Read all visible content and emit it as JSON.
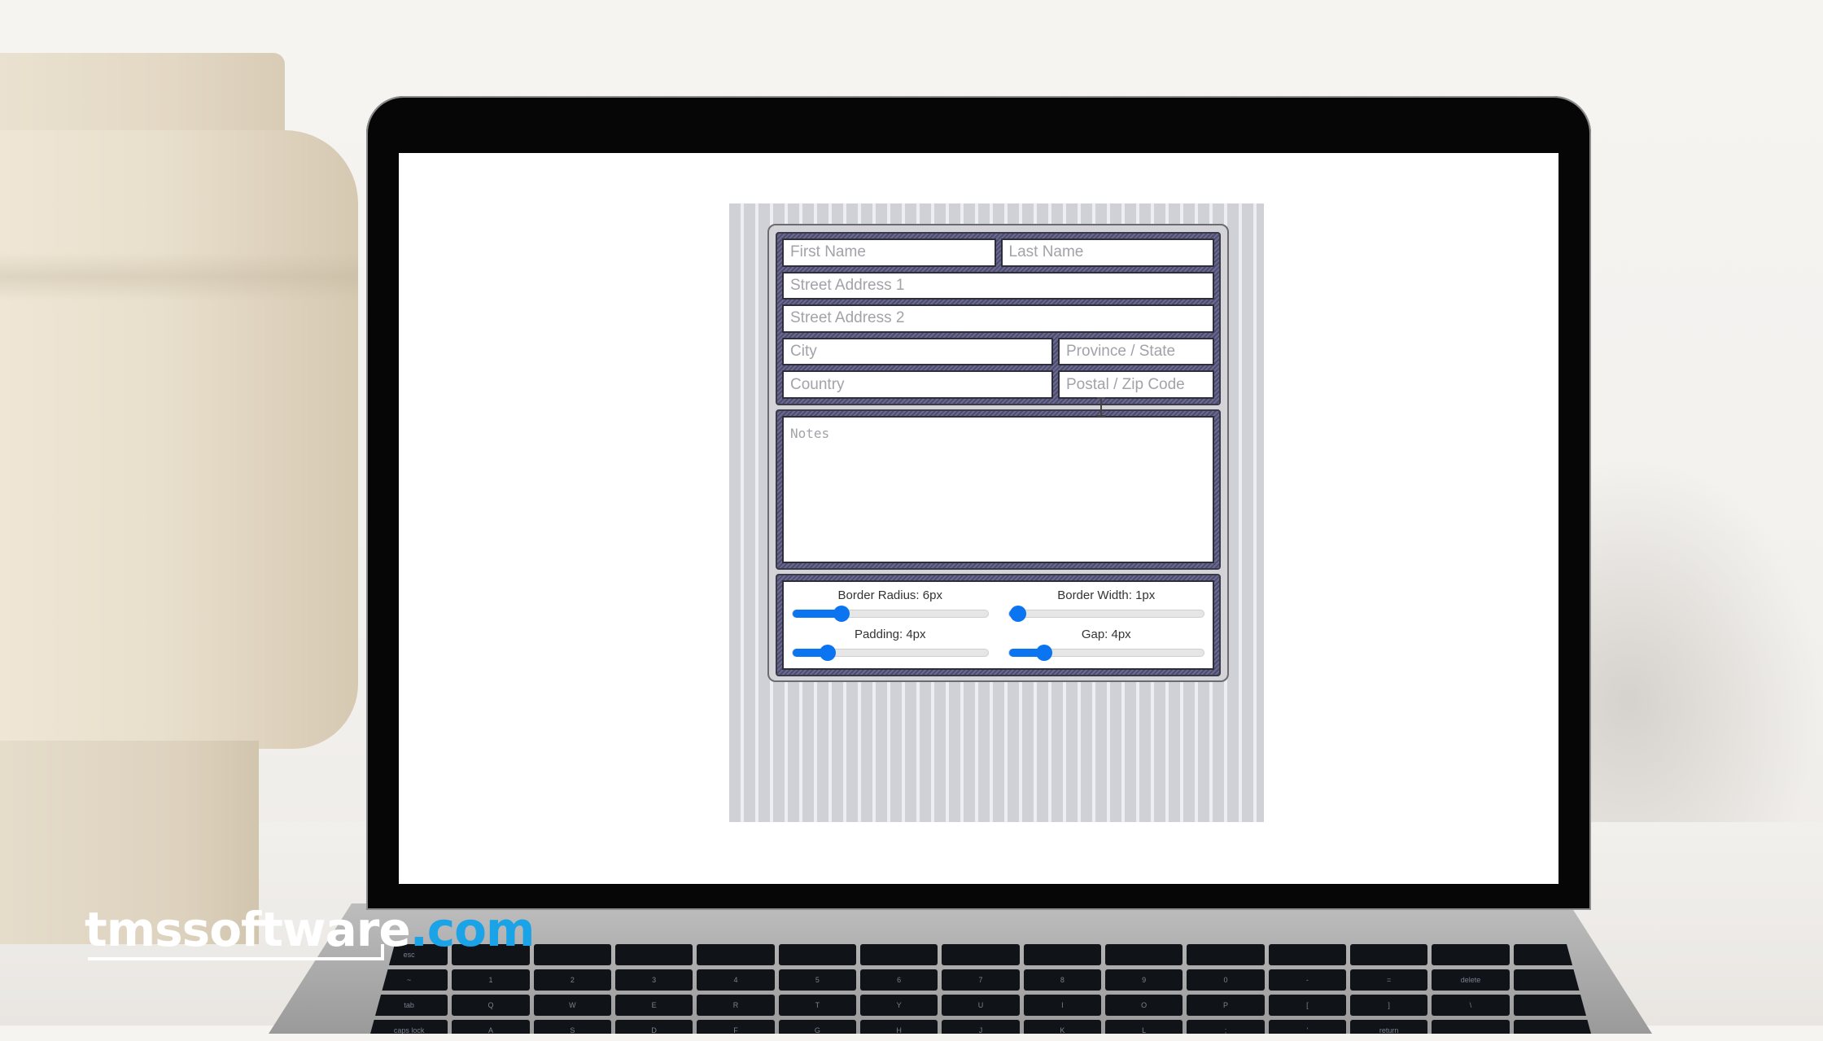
{
  "form": {
    "fields": {
      "first_name": {
        "placeholder": "First Name",
        "value": ""
      },
      "last_name": {
        "placeholder": "Last Name",
        "value": ""
      },
      "street_address_1": {
        "placeholder": "Street Address 1",
        "value": ""
      },
      "street_address_2": {
        "placeholder": "Street Address 2",
        "value": ""
      },
      "city": {
        "placeholder": "City",
        "value": ""
      },
      "province_state": {
        "placeholder": "Province / State",
        "value": ""
      },
      "country": {
        "placeholder": "Country",
        "value": ""
      },
      "postal_zip": {
        "placeholder": "Postal / Zip Code",
        "value": ""
      }
    },
    "notes": {
      "placeholder": "Notes",
      "value": ""
    }
  },
  "sliders": [
    {
      "label": "Border Radius: 6px",
      "value": 6,
      "fraction": 0.25
    },
    {
      "label": "Border Width: 1px",
      "value": 1,
      "fraction": 0.05
    },
    {
      "label": "Padding: 4px",
      "value": 4,
      "fraction": 0.18
    },
    {
      "label": "Gap: 4px",
      "value": 4,
      "fraction": 0.18
    }
  ],
  "colors": {
    "slider_accent": "#0b74f0",
    "group_border": "#4d4c6f",
    "logo_tld": "#1aa3e6"
  },
  "watermark": {
    "main": "tmssoftware",
    "tld": ".com"
  },
  "keyboard": {
    "rows": [
      [
        "esc",
        "",
        "",
        "",
        "",
        "",
        "",
        "",
        "",
        "",
        "",
        "",
        "",
        "",
        ""
      ],
      [
        "~",
        "1",
        "2",
        "3",
        "4",
        "5",
        "6",
        "7",
        "8",
        "9",
        "0",
        "-",
        "=",
        "delete",
        ""
      ],
      [
        "tab",
        "Q",
        "W",
        "E",
        "R",
        "T",
        "Y",
        "U",
        "I",
        "O",
        "P",
        "[",
        "]",
        "\\",
        ""
      ],
      [
        "caps lock",
        "A",
        "S",
        "D",
        "F",
        "G",
        "H",
        "J",
        "K",
        "L",
        ";",
        "'",
        "return",
        "",
        ""
      ]
    ]
  }
}
